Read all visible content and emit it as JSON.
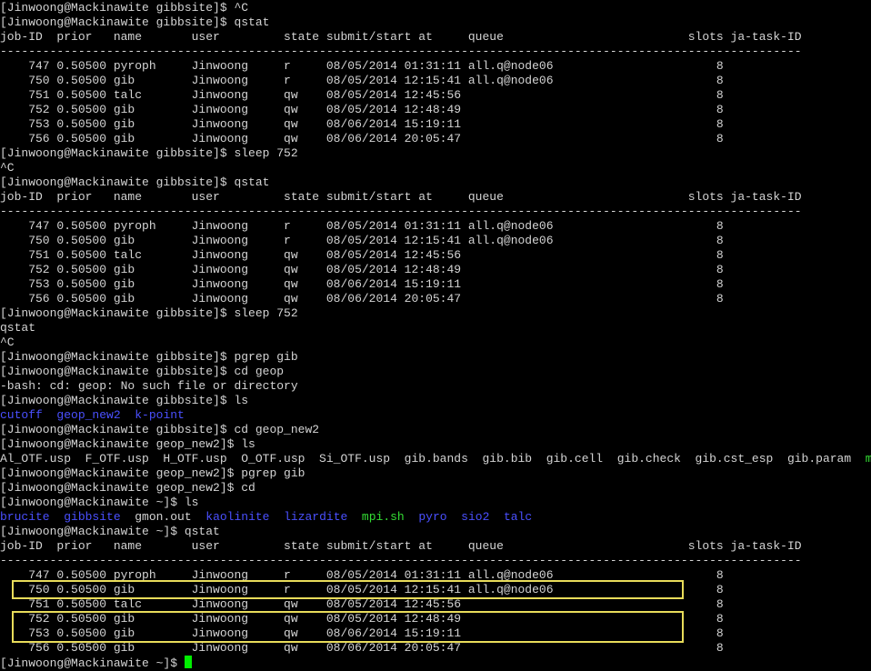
{
  "terminal": {
    "lines": [
      [
        {
          "t": "[Jinwoong@Mackinawite gibbsite]$ ^C",
          "c": "plain"
        }
      ],
      [
        {
          "t": "[Jinwoong@Mackinawite gibbsite]$ qstat",
          "c": "plain"
        }
      ],
      [
        {
          "t": "job-ID  prior   name       user         state submit/start at     queue                          slots ja-task-ID",
          "c": "plain"
        }
      ],
      [
        {
          "t": "-----------------------------------------------------------------------------------------------------------------",
          "c": "plain"
        }
      ],
      [
        {
          "t": "    747 0.50500 pyroph     Jinwoong     r     08/05/2014 01:31:11 all.q@node06                       8",
          "c": "plain"
        }
      ],
      [
        {
          "t": "    750 0.50500 gib        Jinwoong     r     08/05/2014 12:15:41 all.q@node06                       8",
          "c": "plain"
        }
      ],
      [
        {
          "t": "    751 0.50500 talc       Jinwoong     qw    08/05/2014 12:45:56                                    8",
          "c": "plain"
        }
      ],
      [
        {
          "t": "    752 0.50500 gib        Jinwoong     qw    08/05/2014 12:48:49                                    8",
          "c": "plain"
        }
      ],
      [
        {
          "t": "    753 0.50500 gib        Jinwoong     qw    08/06/2014 15:19:11                                    8",
          "c": "plain"
        }
      ],
      [
        {
          "t": "    756 0.50500 gib        Jinwoong     qw    08/06/2014 20:05:47                                    8",
          "c": "plain"
        }
      ],
      [
        {
          "t": "[Jinwoong@Mackinawite gibbsite]$ sleep 752",
          "c": "plain"
        }
      ],
      [
        {
          "t": "^C",
          "c": "plain"
        }
      ],
      [
        {
          "t": "[Jinwoong@Mackinawite gibbsite]$ qstat",
          "c": "plain"
        }
      ],
      [
        {
          "t": "job-ID  prior   name       user         state submit/start at     queue                          slots ja-task-ID",
          "c": "plain"
        }
      ],
      [
        {
          "t": "-----------------------------------------------------------------------------------------------------------------",
          "c": "plain"
        }
      ],
      [
        {
          "t": "    747 0.50500 pyroph     Jinwoong     r     08/05/2014 01:31:11 all.q@node06                       8",
          "c": "plain"
        }
      ],
      [
        {
          "t": "    750 0.50500 gib        Jinwoong     r     08/05/2014 12:15:41 all.q@node06                       8",
          "c": "plain"
        }
      ],
      [
        {
          "t": "    751 0.50500 talc       Jinwoong     qw    08/05/2014 12:45:56                                    8",
          "c": "plain"
        }
      ],
      [
        {
          "t": "    752 0.50500 gib        Jinwoong     qw    08/05/2014 12:48:49                                    8",
          "c": "plain"
        }
      ],
      [
        {
          "t": "    753 0.50500 gib        Jinwoong     qw    08/06/2014 15:19:11                                    8",
          "c": "plain"
        }
      ],
      [
        {
          "t": "    756 0.50500 gib        Jinwoong     qw    08/06/2014 20:05:47                                    8",
          "c": "plain"
        }
      ],
      [
        {
          "t": "[Jinwoong@Mackinawite gibbsite]$ sleep 752",
          "c": "plain"
        }
      ],
      [
        {
          "t": "qstat",
          "c": "plain"
        }
      ],
      [
        {
          "t": "^C",
          "c": "plain"
        }
      ],
      [
        {
          "t": "[Jinwoong@Mackinawite gibbsite]$ pgrep gib",
          "c": "plain"
        }
      ],
      [
        {
          "t": "[Jinwoong@Mackinawite gibbsite]$ cd geop",
          "c": "plain"
        }
      ],
      [
        {
          "t": "-bash: cd: geop: No such file or directory",
          "c": "plain"
        }
      ],
      [
        {
          "t": "[Jinwoong@Mackinawite gibbsite]$ ls",
          "c": "plain"
        }
      ],
      [
        {
          "t": "cutoff",
          "c": "dir"
        },
        {
          "t": "  ",
          "c": "plain"
        },
        {
          "t": "geop_new2",
          "c": "dir"
        },
        {
          "t": "  ",
          "c": "plain"
        },
        {
          "t": "k-point",
          "c": "dir"
        }
      ],
      [
        {
          "t": "[Jinwoong@Mackinawite gibbsite]$ cd geop_new2",
          "c": "plain"
        }
      ],
      [
        {
          "t": "[Jinwoong@Mackinawite geop_new2]$ ls",
          "c": "plain"
        }
      ],
      [
        {
          "t": "Al_OTF.usp  F_OTF.usp  H_OTF.usp  O_OTF.usp  Si_OTF.usp  gib.bands  gib.bib  gib.cell  gib.check  gib.cst_esp  gib.param  ",
          "c": "file"
        },
        {
          "t": "mpi.sh",
          "c": "exec"
        }
      ],
      [
        {
          "t": "[Jinwoong@Mackinawite geop_new2]$ pgrep gib",
          "c": "plain"
        }
      ],
      [
        {
          "t": "[Jinwoong@Mackinawite geop_new2]$ cd",
          "c": "plain"
        }
      ],
      [
        {
          "t": "[Jinwoong@Mackinawite ~]$ ls",
          "c": "plain"
        }
      ],
      [
        {
          "t": "brucite",
          "c": "dir"
        },
        {
          "t": "  ",
          "c": "plain"
        },
        {
          "t": "gibbsite",
          "c": "dir"
        },
        {
          "t": "  gmon.out  ",
          "c": "file"
        },
        {
          "t": "kaolinite",
          "c": "dir"
        },
        {
          "t": "  ",
          "c": "plain"
        },
        {
          "t": "lizardite",
          "c": "dir"
        },
        {
          "t": "  ",
          "c": "plain"
        },
        {
          "t": "mpi.sh",
          "c": "exec"
        },
        {
          "t": "  ",
          "c": "plain"
        },
        {
          "t": "pyro",
          "c": "dir"
        },
        {
          "t": "  ",
          "c": "plain"
        },
        {
          "t": "sio2",
          "c": "dir"
        },
        {
          "t": "  ",
          "c": "plain"
        },
        {
          "t": "talc",
          "c": "dir"
        }
      ],
      [
        {
          "t": "[Jinwoong@Mackinawite ~]$ qstat",
          "c": "plain"
        }
      ],
      [
        {
          "t": "job-ID  prior   name       user         state submit/start at     queue                          slots ja-task-ID",
          "c": "plain"
        }
      ],
      [
        {
          "t": "-----------------------------------------------------------------------------------------------------------------",
          "c": "plain"
        }
      ],
      [
        {
          "t": "    747 0.50500 pyroph     Jinwoong     r     08/05/2014 01:31:11 all.q@node06                       8",
          "c": "plain"
        }
      ],
      [
        {
          "t": "    750 0.50500 gib        Jinwoong     r     08/05/2014 12:15:41 all.q@node06                       8",
          "c": "plain"
        }
      ],
      [
        {
          "t": "    751 0.50500 talc       Jinwoong     qw    08/05/2014 12:45:56                                    8",
          "c": "plain"
        }
      ],
      [
        {
          "t": "    752 0.50500 gib        Jinwoong     qw    08/05/2014 12:48:49                                    8",
          "c": "plain"
        }
      ],
      [
        {
          "t": "    753 0.50500 gib        Jinwoong     qw    08/06/2014 15:19:11                                    8",
          "c": "plain"
        }
      ],
      [
        {
          "t": "    756 0.50500 gib        Jinwoong     qw    08/06/2014 20:05:47                                    8",
          "c": "plain"
        }
      ],
      [
        {
          "t": "[Jinwoong@Mackinawite ~]$ ",
          "c": "plain"
        }
      ]
    ]
  },
  "colors": {
    "background": "#000000",
    "text": "#d4d4d4",
    "directory": "#4a50ff",
    "executable": "#33dd33",
    "cursor": "#00ee00",
    "highlight_box": "#e8dc5a"
  }
}
